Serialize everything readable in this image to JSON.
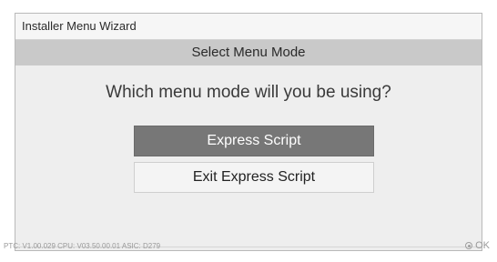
{
  "window": {
    "title": "Installer Menu Wizard"
  },
  "header": {
    "title": "Select Menu Mode"
  },
  "prompt": {
    "question": "Which menu mode will you be using?"
  },
  "options": [
    {
      "label": "Express Script",
      "selected": true
    },
    {
      "label": "Exit Express Script",
      "selected": false
    }
  ],
  "footer": {
    "version_info": "PTC:  V1.00.029 CPU: V03.50.00.01 ASIC: D279",
    "ok_label": "OK",
    "ok_icon": "ok-button-icon"
  },
  "colors": {
    "header_bg": "#c9c9c9",
    "selected_bg": "#777777",
    "panel_bg": "#eeeeee"
  }
}
